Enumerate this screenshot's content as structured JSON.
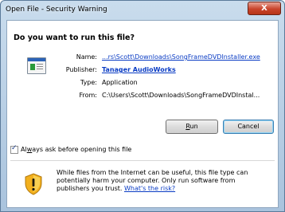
{
  "window": {
    "title": "Open File - Security Warning",
    "close_label": "X"
  },
  "dialog": {
    "heading": "Do you want to run this file?",
    "fields": {
      "name_label": "Name:",
      "name_value": "...rs\\Scott\\Downloads\\SongFrameDVDInstaller.exe",
      "publisher_label": "Publisher:",
      "publisher_value": "Tanager AudioWorks",
      "type_label": "Type:",
      "type_value": "Application",
      "from_label": "From:",
      "from_value": "C:\\Users\\Scott\\Downloads\\SongFrameDVDInstal..."
    },
    "buttons": {
      "run_key": "R",
      "run_rest": "un",
      "cancel": "Cancel"
    },
    "checkbox": {
      "label_before": "Al",
      "label_key": "w",
      "label_after": "ays ask before opening this file",
      "checked": true
    },
    "warning": {
      "text": "While files from the Internet can be useful, this file type can potentially harm your computer. Only run software from publishers you trust.",
      "link": "What's the risk?"
    },
    "icons": {
      "file": "application-file-icon",
      "shield": "security-shield-icon"
    },
    "colors": {
      "link": "#0a3cc4",
      "title_bar": "#c9dced",
      "close_button": "#c9442c"
    }
  }
}
